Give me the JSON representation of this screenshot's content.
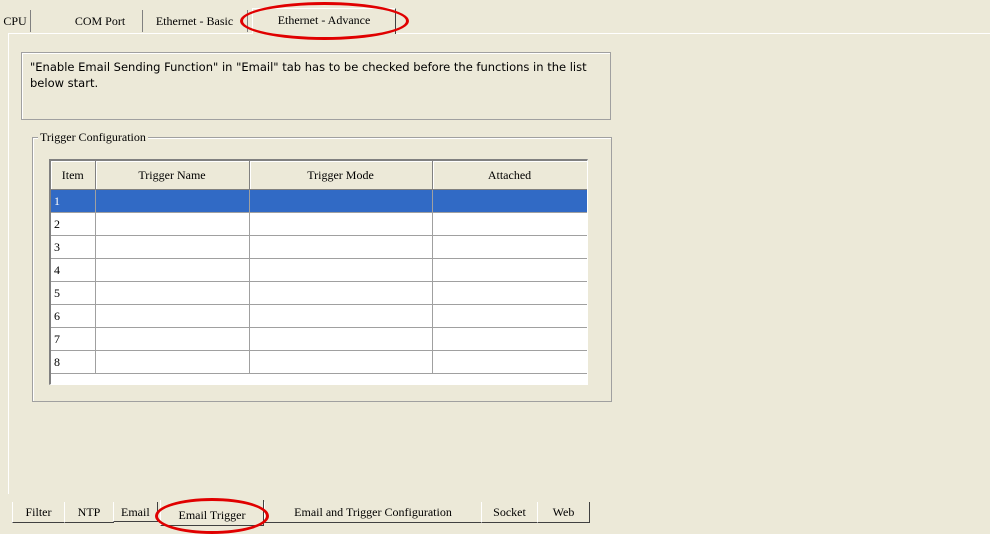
{
  "top_tabs": [
    {
      "label": "CPU"
    },
    {
      "label": "COM Port"
    },
    {
      "label": "Ethernet - Basic"
    },
    {
      "label": "Ethernet - Advance"
    }
  ],
  "active_top_tab": "Ethernet - Advance",
  "notice": {
    "text": "\"Enable Email Sending Function\" in \"Email\" tab has to be checked before the functions in the list below start."
  },
  "trigger_group": {
    "legend": "Trigger Configuration",
    "columns": [
      "Item",
      "Trigger Name",
      "Trigger Mode",
      "Attached"
    ],
    "rows": [
      {
        "item": "1",
        "name": "",
        "mode": "",
        "attached": ""
      },
      {
        "item": "2",
        "name": "",
        "mode": "",
        "attached": ""
      },
      {
        "item": "3",
        "name": "",
        "mode": "",
        "attached": ""
      },
      {
        "item": "4",
        "name": "",
        "mode": "",
        "attached": ""
      },
      {
        "item": "5",
        "name": "",
        "mode": "",
        "attached": ""
      },
      {
        "item": "6",
        "name": "",
        "mode": "",
        "attached": ""
      },
      {
        "item": "7",
        "name": "",
        "mode": "",
        "attached": ""
      },
      {
        "item": "8",
        "name": "",
        "mode": "",
        "attached": ""
      }
    ],
    "selected_row": "1"
  },
  "bottom_tabs": [
    {
      "label": "Filter"
    },
    {
      "label": "NTP"
    },
    {
      "label": "Email"
    },
    {
      "label": "Email Trigger"
    },
    {
      "label": "Email and Trigger Configuration"
    },
    {
      "label": "Socket"
    },
    {
      "label": "Web"
    }
  ],
  "active_bottom_tab": "Email Trigger",
  "colors": {
    "background": "#ece9d8",
    "selection": "#316ac5",
    "highlight_ring": "#e00000"
  }
}
